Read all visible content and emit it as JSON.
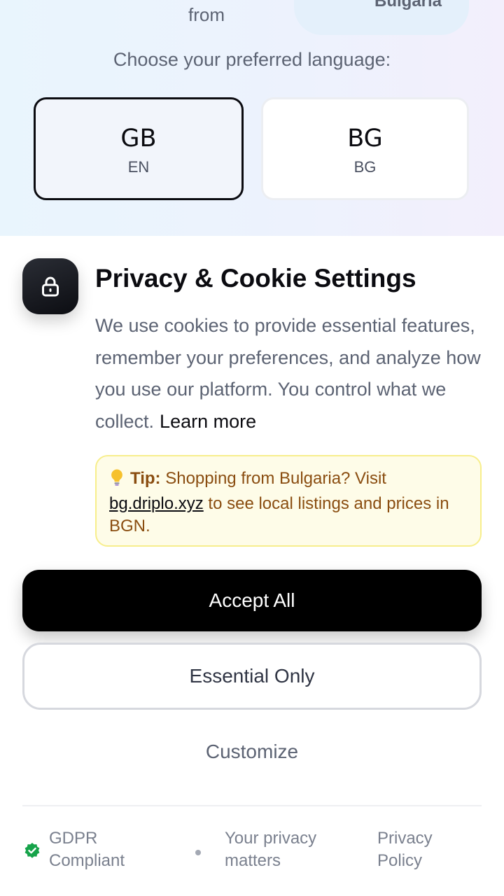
{
  "header": {
    "from_text": "from",
    "country": "Bulgaria",
    "choose_label": "Choose your preferred language:"
  },
  "languages": [
    {
      "code": "GB",
      "sub": "EN",
      "selected": true
    },
    {
      "code": "BG",
      "sub": "BG",
      "selected": false
    }
  ],
  "consent": {
    "title": "Privacy & Cookie Settings",
    "description": "We use cookies to provide essential features, remember your preferences, and analyze how you use our platform. You control what we collect.",
    "learn_more": "Learn more",
    "tip": {
      "icon": "lightbulb-icon",
      "label": "Tip:",
      "text_before": "Shopping from Bulgaria? Visit",
      "link": "bg.driplo.xyz",
      "text_after": "to see local listings and prices in BGN."
    },
    "accept_all": "Accept All",
    "essential_only": "Essential Only",
    "customize": "Customize"
  },
  "footer": {
    "gdpr": "GDPR Compliant",
    "privacy_matters": "Your privacy matters",
    "privacy_policy": "Privacy Policy"
  },
  "colors": {
    "accent": "#000000",
    "tip_bg": "#fefce8",
    "tip_text": "#8a4d10",
    "gdpr_check": "#16a34a"
  }
}
